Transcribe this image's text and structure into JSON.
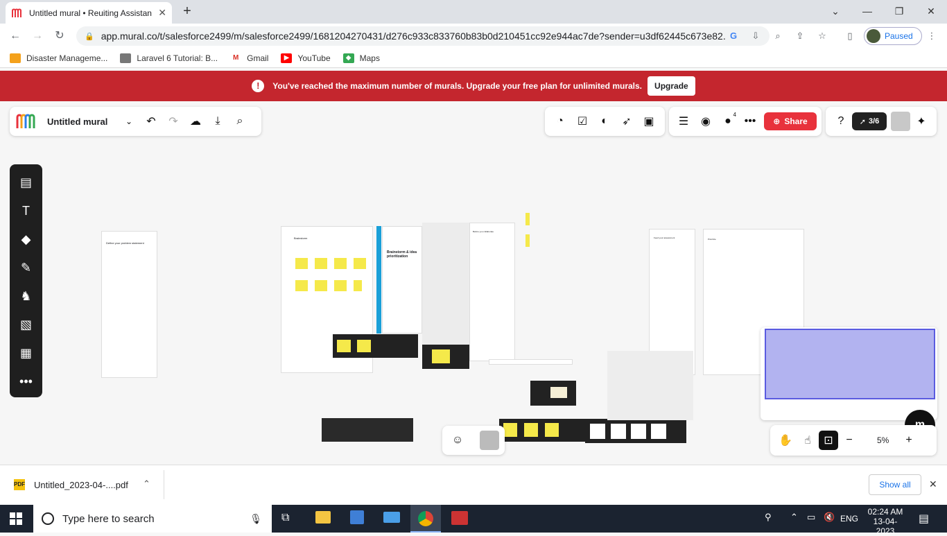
{
  "browser": {
    "tab_title": "Untitled mural • Reuiting Assistan",
    "url": "app.mural.co/t/salesforce2499/m/salesforce2499/1681204270431/d276c933c833760b83b0d210451cc92e944ac7de?sender=u3df62445c673e82...",
    "profile_label": "Paused",
    "bookmarks": [
      "Disaster Manageme...",
      "Laravel 6 Tutorial: B...",
      "Gmail",
      "YouTube",
      "Maps"
    ]
  },
  "banner": {
    "message": "You've reached the maximum number of murals. Upgrade your free plan for unlimited murals.",
    "button": "Upgrade"
  },
  "mural": {
    "title": "Untitled mural",
    "share_label": "Share",
    "member_count": "4",
    "timer_count": "3/6",
    "zoom": "5%"
  },
  "board": {
    "sheet1_title": "Define your problem statement",
    "sheet2_title": "Brainstorm",
    "sheet3_title": "Brainstorm & idea prioritization",
    "sheet4_title": "Before you collaborate",
    "sheet5_title": "Feed your assessment",
    "sheet6_title": "Prioritize"
  },
  "download": {
    "filename": "Untitled_2023-04-....pdf",
    "show_all": "Show all"
  },
  "taskbar": {
    "search_placeholder": "Type here to search",
    "lang": "ENG",
    "time": "02:24 AM",
    "date": "13-04-2023"
  },
  "colors": {
    "banner": "#c4262e",
    "share": "#e8323c",
    "minimap": "#b2b3f0",
    "sticky": "#f5e94a"
  }
}
